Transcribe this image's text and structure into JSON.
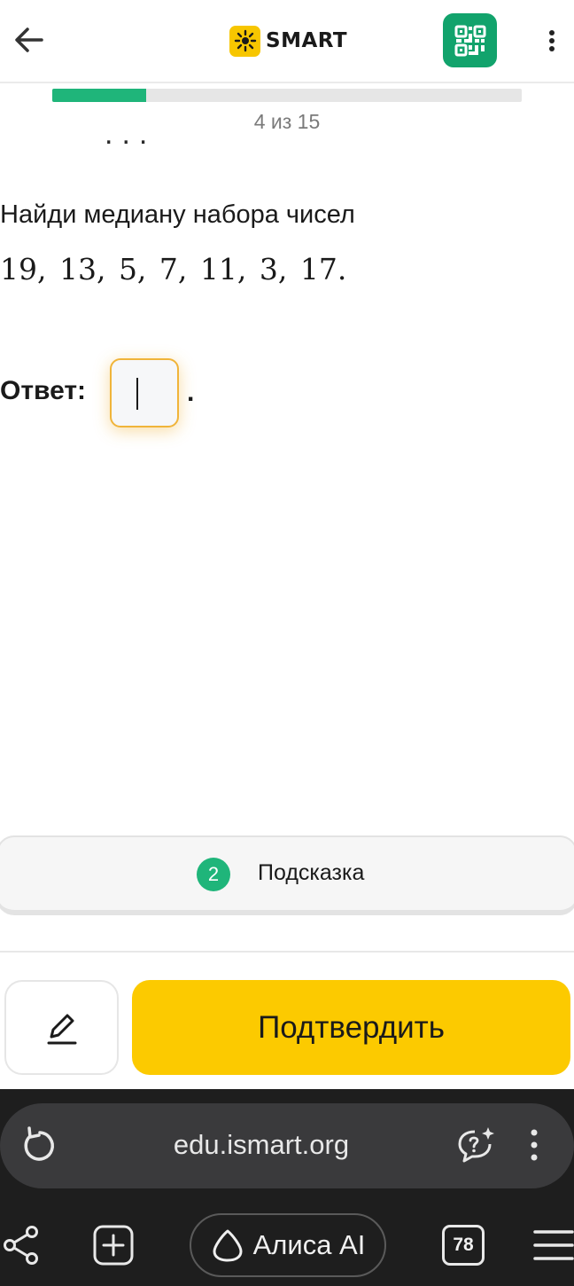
{
  "header": {
    "logo_text": "SMART",
    "brand_color": "#f7c600",
    "qr_color": "#12a36c",
    "icons": [
      "arrow-left-icon",
      "qr-code-icon",
      "more-vertical-icon"
    ]
  },
  "progress": {
    "text": "4 из 15",
    "current": 4,
    "total": 15,
    "fill_fraction": 0.2,
    "fill_color": "#1fb57a"
  },
  "previous_heading_cutoff": "...",
  "task": {
    "title": "Найди медиану набора чисел",
    "numbers": "19,  13,  5,  7,  11,  3,  17."
  },
  "answer": {
    "label": "Ответ:",
    "value": "",
    "suffix": "."
  },
  "hint": {
    "count": "2",
    "label": "Подсказка"
  },
  "actions": {
    "confirm_label": "Подтвердить",
    "confirm_color": "#fcca00",
    "pencil_icon": "pencil-icon"
  },
  "browser": {
    "url": "edu.ismart.org",
    "alice_label": "Алиса AI",
    "tabs_count": "78",
    "icons": [
      "reload-icon",
      "alice-chat-icon",
      "more-vertical-icon",
      "share-icon",
      "new-tab-icon",
      "alice-icon",
      "hamburger-icon"
    ]
  }
}
